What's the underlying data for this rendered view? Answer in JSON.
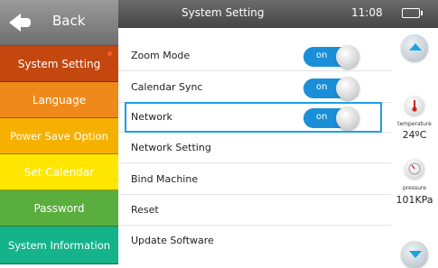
{
  "colors": {
    "accent": "#1a8fd8",
    "highlight_border": "#1aa0e8",
    "battery": "#2adf1a",
    "sidebar": [
      "#c3470f",
      "#ef8a1a",
      "#f6b100",
      "#ffe600",
      "#5aae3e",
      "#14b38a"
    ]
  },
  "sidebar": {
    "back_label": "Back",
    "items": [
      {
        "label": "System Setting",
        "color": "#c3470f",
        "active": true
      },
      {
        "label": "Language",
        "color": "#ef8a1a"
      },
      {
        "label": "Power Save Option",
        "color": "#f6b100"
      },
      {
        "label": "Set Calendar",
        "color": "#ffe600"
      },
      {
        "label": "Password",
        "color": "#5aae3e"
      },
      {
        "label": "System Information",
        "color": "#14b38a"
      }
    ]
  },
  "header": {
    "title": "System Setting",
    "time": "11:08",
    "battery_level": 1.0
  },
  "settings": {
    "rows": [
      {
        "label": "Zoom Mode",
        "toggle": "on"
      },
      {
        "label": "Calendar Sync",
        "toggle": "on"
      },
      {
        "label": "Network",
        "toggle": "on",
        "highlighted": true
      },
      {
        "label": "Network Setting"
      },
      {
        "label": "Bind Machine"
      },
      {
        "label": "Reset"
      },
      {
        "label": "Update Software"
      }
    ]
  },
  "right_panel": {
    "temperature_label": "temperature",
    "temperature_value": "24ºC",
    "pressure_label": "pressure",
    "pressure_value": "101KPa",
    "icons": [
      "scroll-up-icon",
      "thermometer-icon",
      "pressure-gauge-icon",
      "scroll-down-icon"
    ]
  }
}
